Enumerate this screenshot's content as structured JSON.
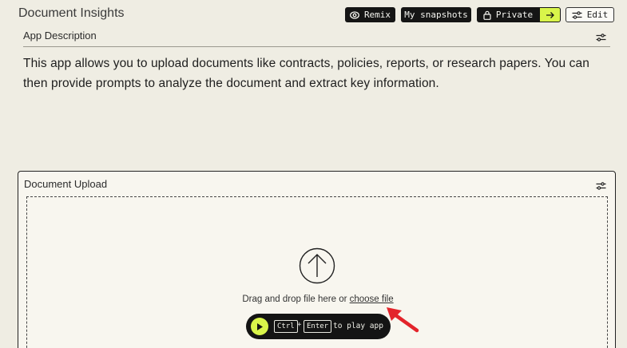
{
  "header": {
    "title": "Document Insights",
    "remix_label": "Remix",
    "snapshots_label": "My snapshots",
    "private_label": "Private",
    "edit_label": "Edit"
  },
  "description": {
    "label": "App Description",
    "text": "This app allows you to upload documents like contracts, policies, reports, or research papers. You can then provide prompts to analyze the document and extract key information."
  },
  "upload": {
    "label": "Document Upload",
    "drop_text": "Drag and drop file here or ",
    "choose_file": "choose file",
    "kbd_ctrl": "Ctrl",
    "kbd_plus": "+",
    "kbd_enter": "Enter",
    "play_caption": "to play app"
  },
  "colors": {
    "background": "#efede3",
    "accent": "#d9f54a",
    "dark": "#151515",
    "pointer": "#e3242b"
  },
  "icons": [
    "eye-icon",
    "lock-icon",
    "arrow-right-icon",
    "sliders-icon",
    "upload-arrow-icon",
    "play-icon",
    "pointer-arrow-icon"
  ]
}
